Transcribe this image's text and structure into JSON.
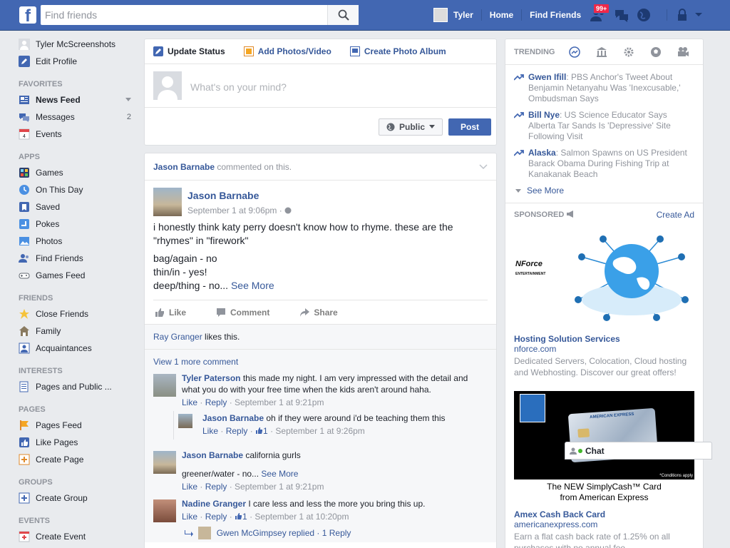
{
  "topbar": {
    "logo": "f",
    "search_placeholder": "Find friends",
    "user_name": "Tyler",
    "home": "Home",
    "find_friends": "Find Friends",
    "friend_requests_badge": "99+"
  },
  "left": {
    "profile_name": "Tyler McScreenshots",
    "edit_profile": "Edit Profile",
    "favorites_head": "FAVORITES",
    "news_feed": "News Feed",
    "messages": "Messages",
    "messages_count": "2",
    "events": "Events",
    "apps_head": "APPS",
    "games": "Games",
    "on_this_day": "On This Day",
    "saved": "Saved",
    "pokes": "Pokes",
    "photos": "Photos",
    "find_friends": "Find Friends",
    "games_feed": "Games Feed",
    "friends_head": "FRIENDS",
    "close_friends": "Close Friends",
    "family": "Family",
    "acquaintances": "Acquaintances",
    "interests_head": "INTERESTS",
    "pages_public": "Pages and Public ...",
    "pages_head": "PAGES",
    "pages_feed": "Pages Feed",
    "like_pages": "Like Pages",
    "create_page": "Create Page",
    "groups_head": "GROUPS",
    "create_group": "Create Group",
    "events_head": "EVENTS",
    "create_event": "Create Event"
  },
  "composer": {
    "update_status": "Update Status",
    "add_photos": "Add Photos/Video",
    "create_album": "Create Photo Album",
    "placeholder": "What's on your mind?",
    "public": "Public",
    "post": "Post"
  },
  "post": {
    "ctx_name": "Jason Barnabe",
    "ctx_text": " commented on this.",
    "author": "Jason Barnabe",
    "time": "September 1 at 9:06pm · ",
    "line1": "i honestly think katy perry doesn't know how to rhyme. these are the \"rhymes\" in \"firework\"",
    "line2": "bag/again - no",
    "line3": "thin/in - yes!",
    "line4": "deep/thing - no... ",
    "see_more": "See More",
    "like": "Like",
    "comment": "Comment",
    "share": "Share",
    "likes_name": "Ray Granger",
    "likes_text": " likes this.",
    "view_more": "View 1 more comment"
  },
  "comments": {
    "c1_author": "Tyler Paterson",
    "c1_text": " this made my night. I am very impressed with the detail and what you do with your free time when the kids aren't around haha.",
    "c1_like": "Like",
    "c1_reply": "Reply",
    "c1_time": " · September 1 at 9:21pm",
    "r1_author": "Jason Barnabe",
    "r1_text": " oh if they were around i'd be teaching them this",
    "r1_like": "Like",
    "r1_reply": "Reply",
    "r1_likes": "1",
    "r1_time": " · September 1 at 9:26pm",
    "c2_author": "Jason Barnabe",
    "c2_text": " california gurls",
    "c2_line2": "greener/water - no... ",
    "c2_see_more": "See More",
    "c2_like": "Like",
    "c2_reply": "Reply",
    "c2_time": " · September 1 at 9:21pm",
    "c3_author": "Nadine Granger",
    "c3_text": " I care less and less the more you bring this up.",
    "c3_like": "Like",
    "c3_reply": "Reply",
    "c3_likes": "1",
    "c3_time": " · September 1 at 10:20pm",
    "replies_text": "Gwen McGimpsey replied · 1 Reply"
  },
  "trending": {
    "head": "TRENDING",
    "t1_name": "Gwen Ifill",
    "t1_text": ": PBS Anchor's Tweet About Benjamin Netanyahu Was 'Inexcusable,' Ombudsman Says",
    "t2_name": "Bill Nye",
    "t2_text": ": US Science Educator Says Alberta Tar Sands Is 'Depressive' Site Following Visit",
    "t3_name": "Alaska",
    "t3_text": ": Salmon Spawns on US President Barack Obama During Fishing Trip at Kanakanak Beach",
    "see_more": "See More"
  },
  "sponsored": {
    "head": "SPONSORED",
    "create_ad": "Create Ad",
    "ad1_logo": "NForce",
    "ad1_logo_sub": "ENTERTAINMENT",
    "ad1_title": "Hosting Solution Services",
    "ad1_domain": "nforce.com",
    "ad1_desc": "Dedicated Servers, Colocation, Cloud hosting and Webhosting. Discover our great offers!",
    "ad2_card_brand": "AMERICAN EXPRESS",
    "ad2_caption1": "The NEW SimplyCash™ Card",
    "ad2_caption2": "from American Express",
    "ad2_fine": "*Conditions apply",
    "ad2_title": "Amex Cash Back Card",
    "ad2_domain": "americanexpress.com",
    "ad2_desc": "Earn a flat cash back rate of 1.25% on all purchases with no annual fee."
  },
  "chat": {
    "label": "Chat"
  },
  "colors": {
    "brand": "#4267b2",
    "link": "#365899",
    "badge": "#f02849"
  }
}
